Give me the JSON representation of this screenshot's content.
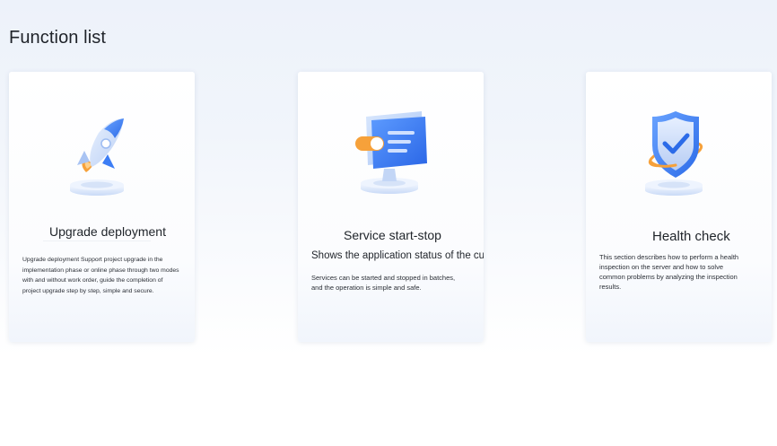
{
  "page": {
    "title": "Function list"
  },
  "cards": [
    {
      "title": "Upgrade deployment",
      "description": "Upgrade deployment Support project upgrade in the\nimplementation phase or online phase through two modes\n with and without work order, guide the completion of\nproject upgrade step by step, simple and secure.",
      "icon": "rocket-icon"
    },
    {
      "title": "Service start-stop",
      "subtitle": "Shows the application status of the current s",
      "description": "Services can be started and stopped in batches,\nand the operation is simple and safe.",
      "icon": "monitor-switch-icon"
    },
    {
      "title": "Health check",
      "description": "This section describes how to perform a health\ninspection on the server and how to solve\ncommon problems by analyzing the inspection\nresults.",
      "icon": "shield-check-icon"
    }
  ],
  "colors": {
    "accent_blue": "#3d7ef5",
    "accent_orange": "#f6a13a",
    "light_blue": "#cfe0fb"
  }
}
